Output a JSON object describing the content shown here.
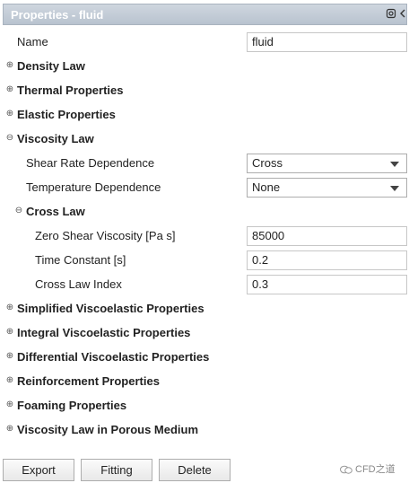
{
  "panel": {
    "title": "Properties - fluid",
    "icons": [
      "settings-icon",
      "collapse-arrow-icon"
    ]
  },
  "rows": {
    "name_label": "Name",
    "name_value": "fluid",
    "density_law": "Density Law",
    "thermal": "Thermal Properties",
    "elastic": "Elastic Properties",
    "viscosity_law": "Viscosity Law",
    "shear_rate_label": "Shear Rate Dependence",
    "shear_rate_value": "Cross",
    "temp_dep_label": "Temperature Dependence",
    "temp_dep_value": "None",
    "cross_law": "Cross Law",
    "zero_shear_label": "Zero Shear Viscosity [Pa s]",
    "zero_shear_value": "85000",
    "time_constant_label": "Time Constant [s]",
    "time_constant_value": "0.2",
    "cross_index_label": "Cross Law Index",
    "cross_index_value": "0.3",
    "simplified_visco": "Simplified Viscoelastic Properties",
    "integral_visco": "Integral Viscoelastic Properties",
    "differential_visco": "Differential Viscoelastic Properties",
    "reinforcement": "Reinforcement Properties",
    "foaming": "Foaming Properties",
    "viscosity_porous": "Viscosity Law in Porous Medium"
  },
  "expanders": {
    "collapsed": "⊕",
    "expanded": "⊖"
  },
  "buttons": {
    "export": "Export",
    "fitting": "Fitting",
    "delete": "Delete"
  },
  "watermark": {
    "text": "CFD之道"
  }
}
